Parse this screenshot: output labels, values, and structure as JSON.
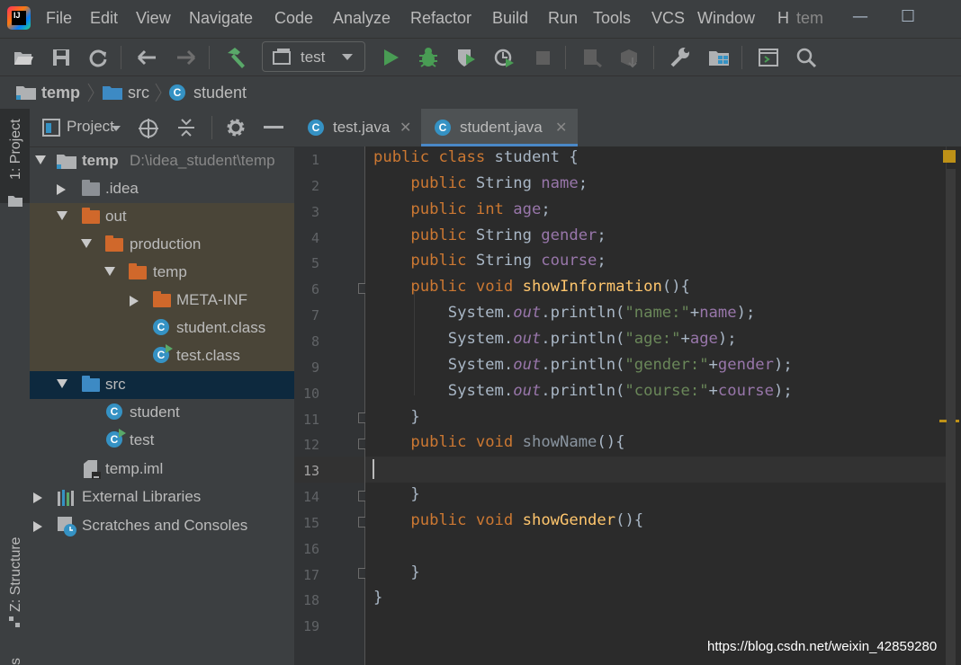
{
  "window": {
    "menu": [
      "File",
      "Edit",
      "View",
      "Navigate",
      "Code",
      "Analyze",
      "Refactor",
      "Build",
      "Run",
      "Tools",
      "VCS",
      "Window",
      "H",
      "tem"
    ],
    "controls": {
      "minimize": "—",
      "maximize": "☐"
    }
  },
  "toolbar": {
    "run_config": "test",
    "icons": [
      "open-folder-icon",
      "save-icon",
      "sync-icon",
      "back-icon",
      "forward-icon",
      "build-hammer-icon",
      "run-config-dropdown",
      "run-icon",
      "debug-icon",
      "coverage-icon",
      "profile-icon",
      "stop-icon",
      "attach-icon",
      "deploy-icon",
      "settings-wrench-icon",
      "project-structure-icon",
      "terminal-icon",
      "search-icon"
    ]
  },
  "breadcrumb": {
    "project": "temp",
    "folder": "src",
    "file": "student"
  },
  "sidebar": {
    "project_tab": "1: Project",
    "structure_tab": "Z: Structure",
    "bottom_tab": "s"
  },
  "project_panel": {
    "title": "Project",
    "tree": [
      {
        "label": "temp",
        "path": "D:\\idea_student\\temp",
        "depth": 0,
        "expanded": true,
        "icon": "module-folder"
      },
      {
        "label": ".idea",
        "depth": 1,
        "expanded": false,
        "icon": "folder-grey"
      },
      {
        "label": "out",
        "depth": 1,
        "expanded": true,
        "icon": "folder-orange"
      },
      {
        "label": "production",
        "depth": 2,
        "expanded": true,
        "icon": "folder-orange"
      },
      {
        "label": "temp",
        "depth": 3,
        "expanded": true,
        "icon": "folder-orange"
      },
      {
        "label": "META-INF",
        "depth": 4,
        "expanded": false,
        "icon": "folder-orange"
      },
      {
        "label": "student.class",
        "depth": 4,
        "icon": "class"
      },
      {
        "label": "test.class",
        "depth": 4,
        "icon": "class-run"
      },
      {
        "label": "src",
        "depth": 1,
        "expanded": true,
        "icon": "folder-blue",
        "selected": true
      },
      {
        "label": "student",
        "depth": 2,
        "icon": "class"
      },
      {
        "label": "test",
        "depth": 2,
        "icon": "class-run"
      },
      {
        "label": "temp.iml",
        "depth": 1,
        "icon": "iml-file"
      },
      {
        "label": "External Libraries",
        "depth": 0,
        "expanded": false,
        "icon": "libraries"
      },
      {
        "label": "Scratches and Consoles",
        "depth": 0,
        "expanded": false,
        "icon": "scratches"
      }
    ]
  },
  "editor": {
    "tabs": [
      {
        "label": "test.java",
        "active": false
      },
      {
        "label": "student.java",
        "active": true
      }
    ],
    "current_line": 13,
    "line_numbers": [
      "1",
      "2",
      "3",
      "4",
      "5",
      "6",
      "7",
      "8",
      "9",
      "10",
      "11",
      "12",
      "13",
      "14",
      "15",
      "16",
      "17",
      "18",
      "19"
    ],
    "code_lines": [
      "public class student {",
      "    public String name;",
      "    public int age;",
      "    public String gender;",
      "    public String course;",
      "    public void showInformation(){",
      "        System.out.println(\"name:\"+name);",
      "        System.out.println(\"age:\"+age);",
      "        System.out.println(\"gender:\"+gender);",
      "        System.out.println(\"course:\"+course);",
      "    }",
      "    public void showName(){",
      "",
      "    }",
      "    public void showGender(){",
      "",
      "    }",
      "}",
      ""
    ]
  },
  "watermark": "https://blog.csdn.net/weixin_42859280",
  "colors": {
    "keyword": "#cc7832",
    "field": "#9876aa",
    "method": "#ffc66d",
    "string": "#6a8759",
    "text": "#a9b7c6",
    "selection": "#0d293e",
    "output_bg": "#4a4538"
  }
}
